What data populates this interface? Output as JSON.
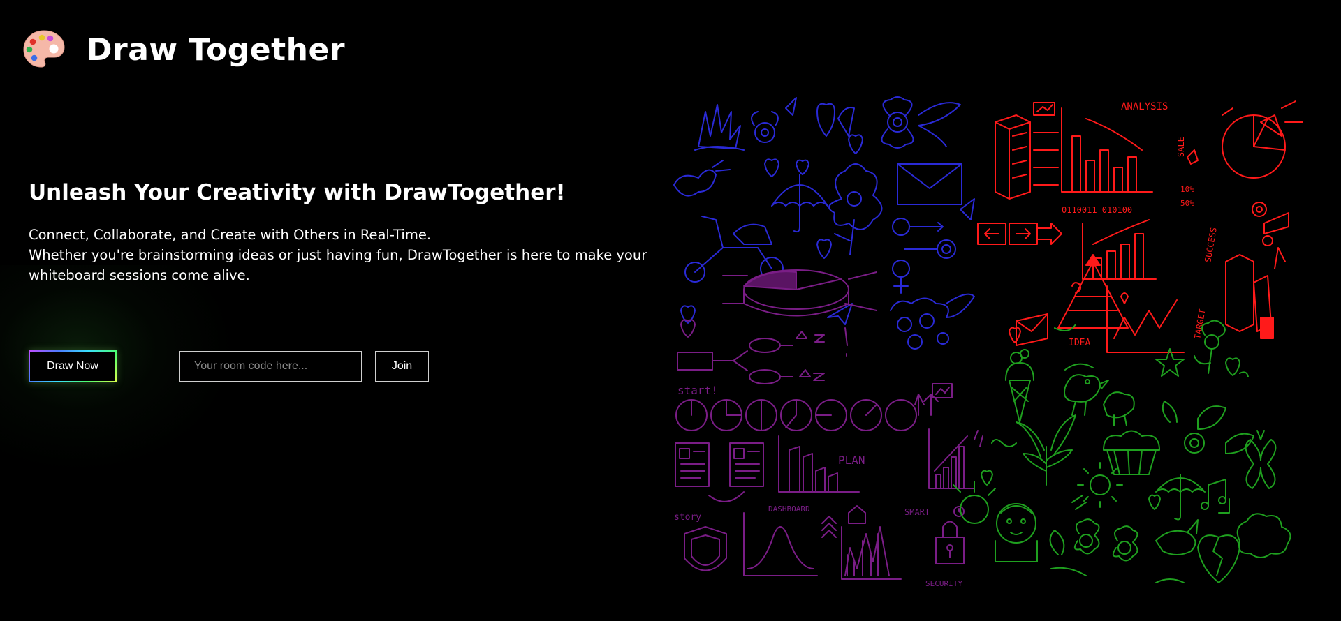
{
  "header": {
    "logo_icon": "palette-icon",
    "title": "Draw Together"
  },
  "hero": {
    "heading": "Unleash Your Creativity with DrawTogether!",
    "line1": "Connect, Collaborate, and Create with Others in Real-Time.",
    "line2": "Whether you're brainstorming ideas or just having fun, DrawTogether is here to make your whiteboard sessions come alive."
  },
  "actions": {
    "draw_now_label": "Draw Now",
    "room_code_placeholder": "Your room code here...",
    "room_code_value": "",
    "join_label": "Join"
  },
  "illustration": {
    "texts": {
      "analysis": "ANALYSIS",
      "sale": "SALE",
      "success": "SUCCESS",
      "target": "TARGET",
      "idea": "IDEA",
      "binary": "0110011 010100",
      "pct10": "10%",
      "pct50": "50%",
      "start": "start!",
      "plan": "PLAN",
      "story": "story",
      "dashboard": "DASHBOARD",
      "smart": "SMART",
      "security": "SECURITY"
    },
    "colors": {
      "blue": "#2a2ad6",
      "red": "#ff1a1a",
      "purple": "#7a1d86",
      "green": "#1fa01f"
    }
  }
}
